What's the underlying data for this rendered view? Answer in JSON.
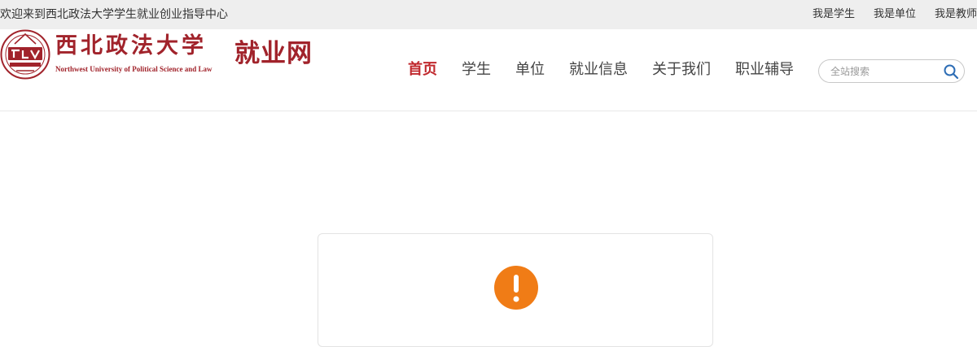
{
  "topbar": {
    "welcome": "欢迎来到西北政法大学学生就业创业指导中心",
    "links": [
      {
        "label": "我是学生"
      },
      {
        "label": "我是单位"
      },
      {
        "label": "我是教师"
      }
    ]
  },
  "logo": {
    "school_name_cn": "西北政法大学",
    "school_name_en": "Northwest University of Political Science and Law",
    "site_name": "就业网"
  },
  "nav": [
    {
      "label": "首页",
      "active": true
    },
    {
      "label": "学生"
    },
    {
      "label": "单位"
    },
    {
      "label": "就业信息"
    },
    {
      "label": "关于我们"
    },
    {
      "label": "职业辅导"
    }
  ],
  "search": {
    "placeholder": "全站搜索",
    "icon": "search-icon"
  },
  "notice": {
    "icon": "exclamation-icon"
  },
  "colors": {
    "brand": "#a1232b",
    "nav_active": "#c0282d",
    "alert": "#f07c16",
    "search_icon": "#2d6db5"
  }
}
